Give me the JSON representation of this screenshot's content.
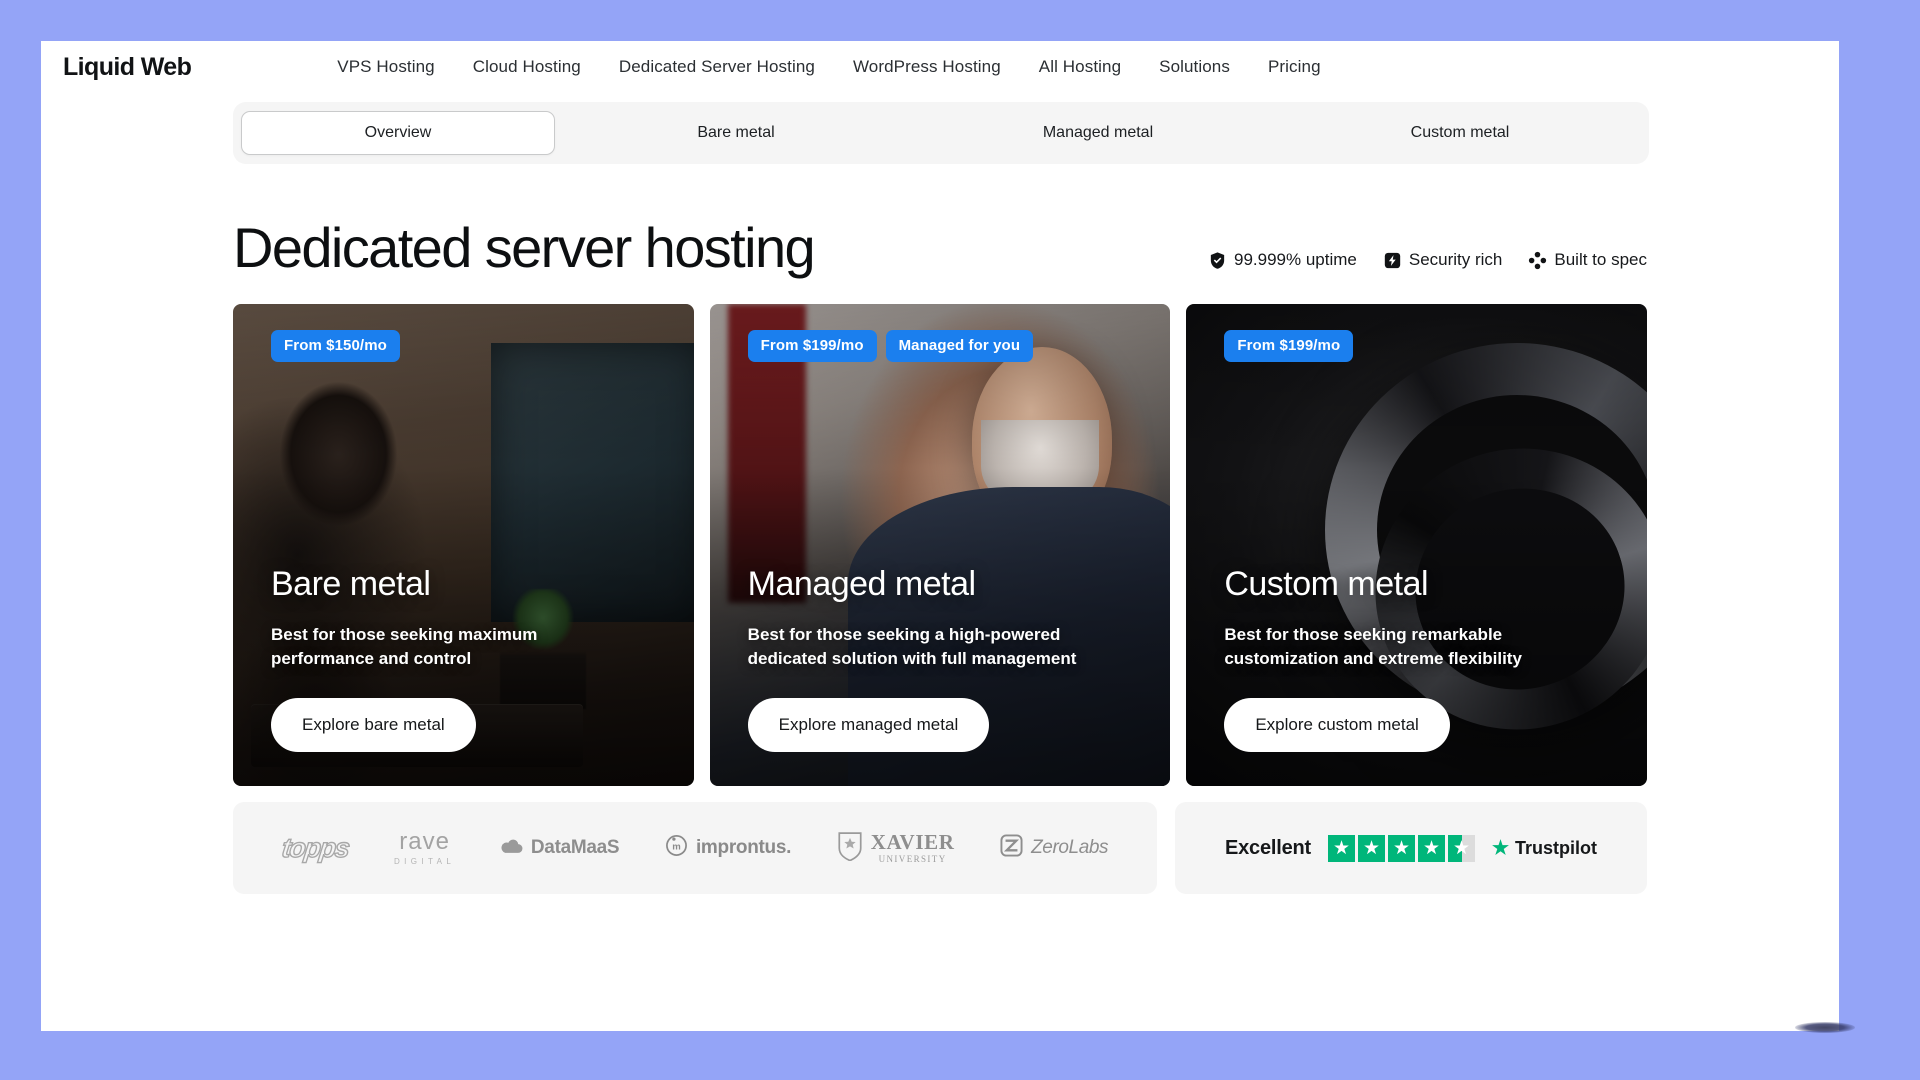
{
  "theme": {
    "page_background": "#94a4f7",
    "frame_background": "#ffffff",
    "badge_blue": "#1b7fee",
    "panel_gray": "#f5f5f5",
    "trustpilot_green": "#00b67a",
    "heading_color": "#0d0f11"
  },
  "nav": {
    "brand": "Liquid Web",
    "links": [
      {
        "label": "VPS Hosting"
      },
      {
        "label": "Cloud Hosting"
      },
      {
        "label": "Dedicated Server Hosting"
      },
      {
        "label": "WordPress Hosting"
      },
      {
        "label": "All Hosting"
      },
      {
        "label": "Solutions"
      },
      {
        "label": "Pricing"
      }
    ]
  },
  "tabs": {
    "items": [
      {
        "label": "Overview",
        "active": true
      },
      {
        "label": "Bare metal",
        "active": false
      },
      {
        "label": "Managed metal",
        "active": false
      },
      {
        "label": "Custom metal",
        "active": false
      }
    ]
  },
  "hero": {
    "title": "Dedicated server hosting",
    "features": [
      {
        "icon": "shield-check-icon",
        "label": "99.999% uptime"
      },
      {
        "icon": "lightning-bolt-icon",
        "label": "Security rich"
      },
      {
        "icon": "four-dots-icon",
        "label": "Built to spec"
      }
    ]
  },
  "cards": [
    {
      "id": "bare-metal",
      "badges": [
        "From $150/mo"
      ],
      "title": "Bare metal",
      "description": "Best for those seeking maximum performance and control",
      "cta": "Explore bare metal"
    },
    {
      "id": "managed-metal",
      "badges": [
        "From $199/mo",
        "Managed for you"
      ],
      "title": "Managed metal",
      "description": "Best for those seeking a high-powered dedicated solution with full management",
      "cta": "Explore managed metal"
    },
    {
      "id": "custom-metal",
      "badges": [
        "From $199/mo"
      ],
      "title": "Custom metal",
      "description": "Best for those seeking remarkable customization and extreme flexibility",
      "cta": "Explore custom metal"
    }
  ],
  "logos": [
    {
      "id": "topps",
      "name": "topps"
    },
    {
      "id": "rave-digital",
      "name": "rave",
      "sub": "DIGITAL"
    },
    {
      "id": "datamaas",
      "name": "DataMaaS"
    },
    {
      "id": "improntus",
      "name": "improntus."
    },
    {
      "id": "xavier-university",
      "name": "XAVIER",
      "sub": "UNIVERSITY"
    },
    {
      "id": "zerolabs",
      "name": "ZeroLabs"
    }
  ],
  "trustpilot": {
    "rating_word": "Excellent",
    "stars_filled": 4,
    "stars_total": 5,
    "half_star": true,
    "brand": "Trustpilot"
  }
}
